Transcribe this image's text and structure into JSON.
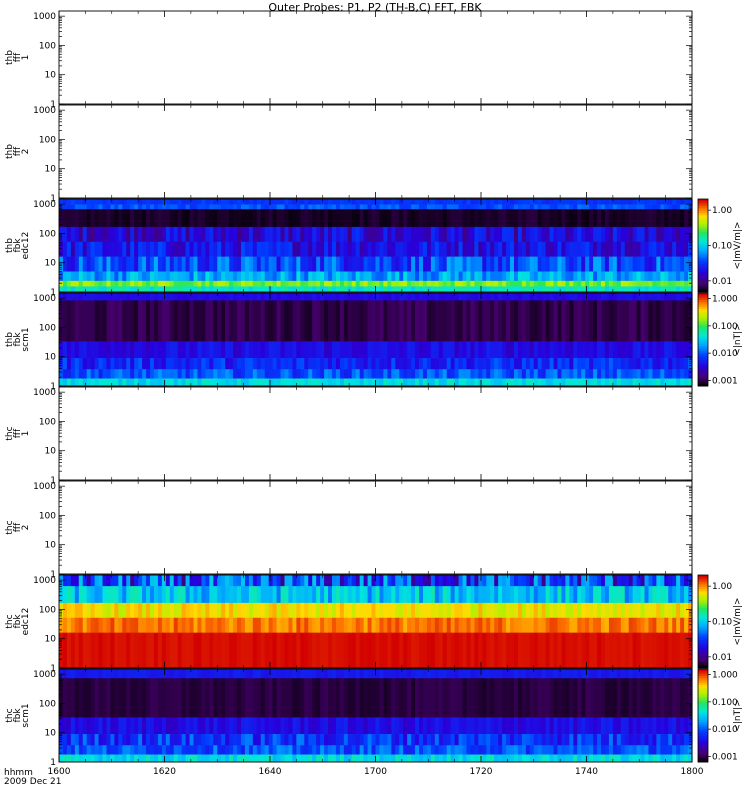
{
  "title": "Outer Probes: P1, P2 (TH-B,C) FFT, FBK",
  "footer": {
    "time_label": "hhmm",
    "date_label": "2009 Dec 21"
  },
  "chart_data": {
    "type": "heatmap",
    "title": "Outer Probes: P1, P2 (TH-B,C) FFT, FBK",
    "x_ticks": [
      "1600",
      "1620",
      "1640",
      "1700",
      "1720",
      "1740",
      "1800"
    ],
    "x_range": [
      "1600",
      "1800"
    ],
    "y_scale": "log",
    "y_range": [
      1,
      1500
    ],
    "y_ticks": [
      "1",
      "10",
      "100",
      "1000"
    ],
    "panels": [
      {
        "label": [
          "thb",
          "fff",
          "1"
        ],
        "empty": true
      },
      {
        "label": [
          "thb",
          "fff",
          "2"
        ],
        "empty": true
      },
      {
        "label": [
          "thb",
          "fbk",
          "edc12"
        ],
        "empty": false,
        "colorbar": {
          "ticks": [
            "1.00",
            "0.10",
            "0.01"
          ],
          "unit": "<|mV/m|>"
        }
      },
      {
        "label": [
          "thb",
          "fbk",
          "scm1"
        ],
        "empty": false,
        "colorbar": {
          "ticks": [
            "1.000",
            "0.100",
            "0.010",
            "0.001"
          ],
          "unit": "<|nT|>"
        }
      },
      {
        "label": [
          "thc",
          "fff",
          "1"
        ],
        "empty": true
      },
      {
        "label": [
          "thc",
          "fff",
          "2"
        ],
        "empty": true
      },
      {
        "label": [
          "thc",
          "fbk",
          "edc12"
        ],
        "empty": false,
        "colorbar": {
          "ticks": [
            "1.00",
            "0.10",
            "0.01"
          ],
          "unit": "<|mV/m|>"
        }
      },
      {
        "label": [
          "thc",
          "fbk",
          "scm1"
        ],
        "empty": false,
        "colorbar": {
          "ticks": [
            "1.000",
            "0.100",
            "0.010",
            "0.001"
          ],
          "unit": "<|nT|>"
        }
      }
    ]
  }
}
